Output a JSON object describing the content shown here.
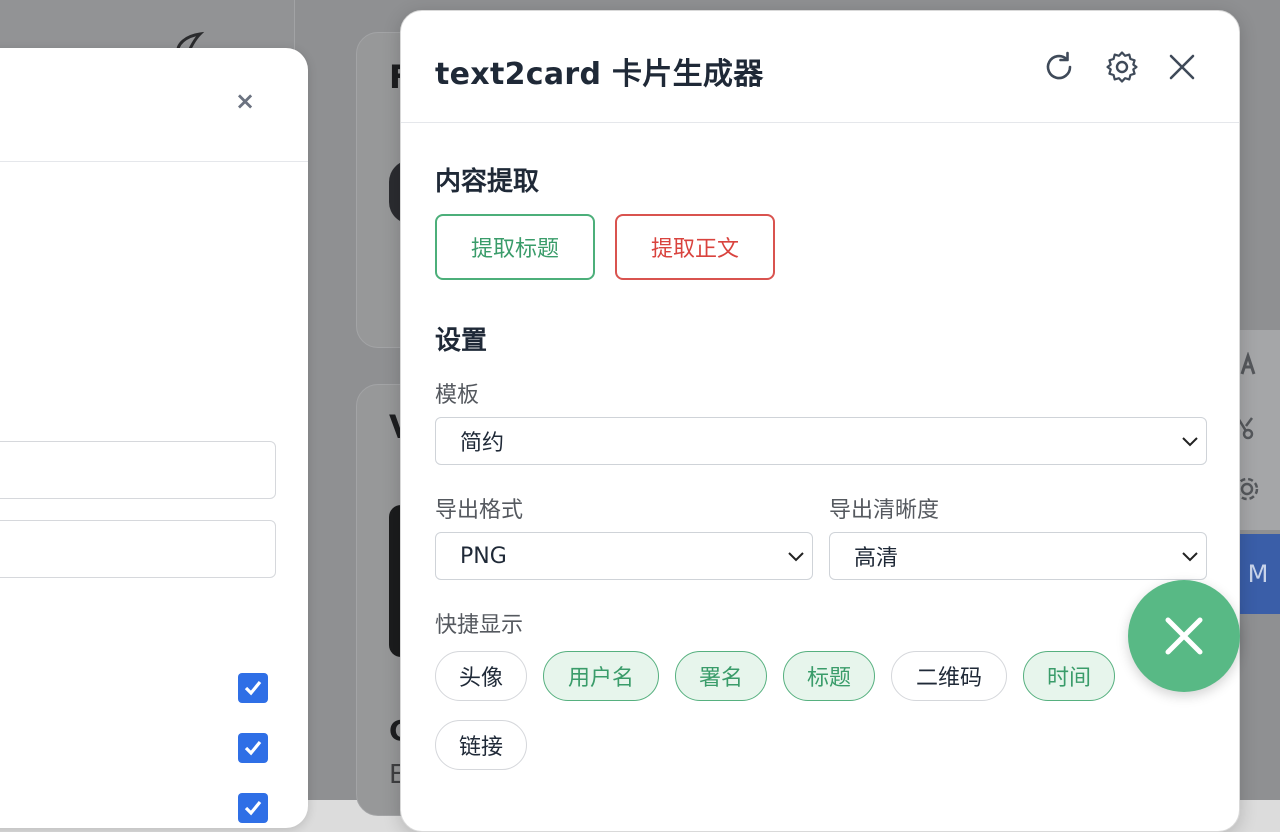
{
  "background": {
    "card1_letter": "F",
    "card2_letter": "V",
    "card3_letter": "C",
    "card4_letter": "E",
    "toolbar_button_letter": "M"
  },
  "left_panel": {
    "close_label": "×"
  },
  "dialog": {
    "title": "text2card 卡片生成器",
    "icons": [
      "refresh-icon",
      "gear-icon",
      "close-icon"
    ],
    "extract": {
      "heading": "内容提取",
      "extract_title_label": "提取标题",
      "extract_body_label": "提取正文"
    },
    "settings": {
      "heading": "设置",
      "template_label": "模板",
      "template_value": "简约",
      "export_format_label": "导出格式",
      "export_format_value": "PNG",
      "export_quality_label": "导出清晰度",
      "export_quality_value": "高清",
      "quick_display_label": "快捷显示",
      "chips": [
        {
          "label": "头像",
          "active": false
        },
        {
          "label": "用户名",
          "active": true
        },
        {
          "label": "署名",
          "active": true
        },
        {
          "label": "标题",
          "active": true
        },
        {
          "label": "二维码",
          "active": false
        },
        {
          "label": "时间",
          "active": true
        },
        {
          "label": "链接",
          "active": false
        }
      ]
    }
  },
  "colors": {
    "accent_green": "#58b985",
    "extract_red": "#d9433e",
    "checkbox_blue": "#2f6fe6"
  }
}
